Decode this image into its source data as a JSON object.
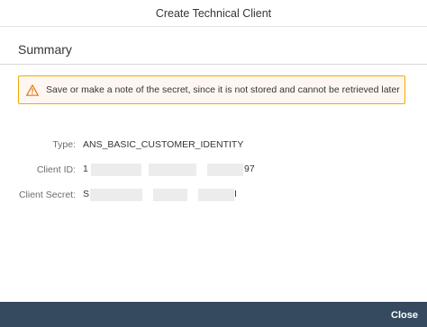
{
  "dialog": {
    "title": "Create Technical Client",
    "section_title": "Summary",
    "warning": {
      "icon": "warning-icon",
      "message": "Save or make a note of the secret, since it is not stored and cannot be retrieved later",
      "color": "#f0ab00"
    },
    "fields": {
      "type": {
        "label": "Type:",
        "value": "ANS_BASIC_CUSTOMER_IDENTITY"
      },
      "client_id": {
        "label": "Client ID:",
        "visible_prefix": "1",
        "visible_suffix": "97"
      },
      "client_secret": {
        "label": "Client Secret:",
        "visible_prefix": "S",
        "visible_suffix": "I"
      }
    },
    "footer": {
      "close_label": "Close",
      "color": "#354a5f"
    }
  }
}
